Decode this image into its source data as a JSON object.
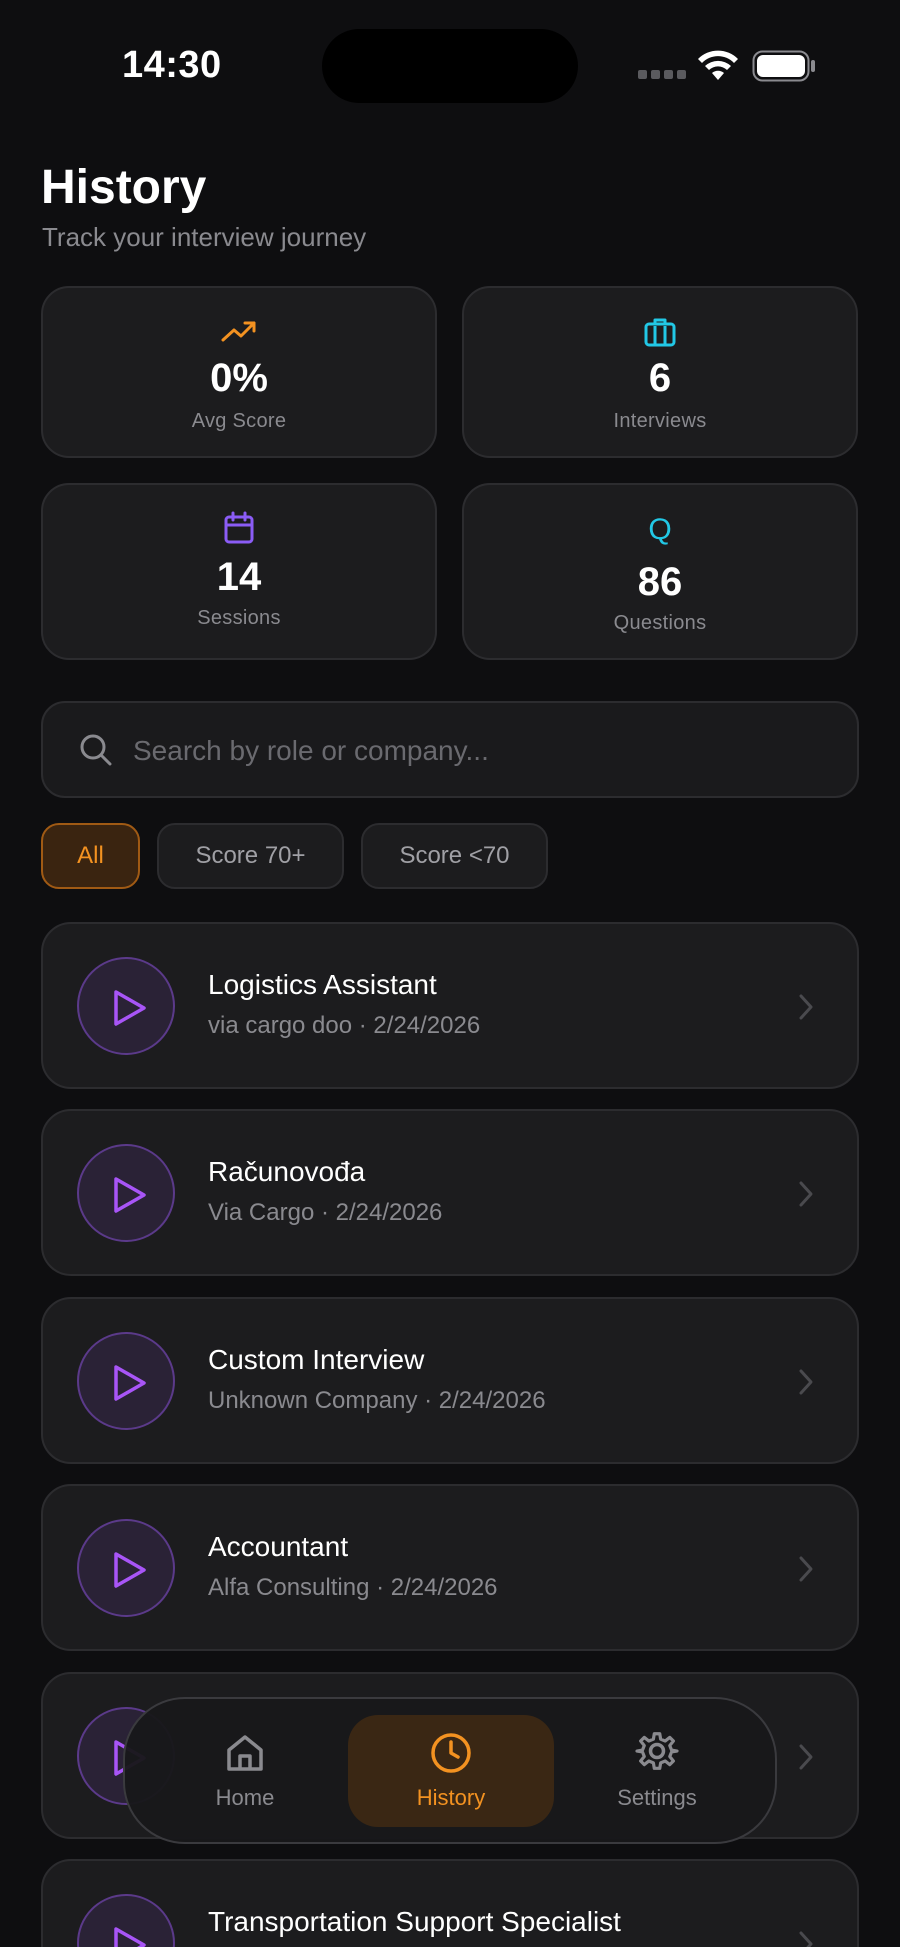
{
  "status_bar": {
    "time": "14:30"
  },
  "header": {
    "title": "History",
    "subtitle": "Track your interview journey"
  },
  "stats": [
    {
      "value": "0%",
      "label": "Avg Score",
      "icon": "trending-up-icon",
      "color": "#f39221"
    },
    {
      "value": "6",
      "label": "Interviews",
      "icon": "briefcase-icon",
      "color": "#22c8e6"
    },
    {
      "value": "14",
      "label": "Sessions",
      "icon": "calendar-icon",
      "color": "#8b5cf6"
    },
    {
      "value": "86",
      "label": "Questions",
      "icon": "q-icon",
      "icon_text": "Q",
      "color": "#22c8e6"
    }
  ],
  "search": {
    "placeholder": "Search by role or company..."
  },
  "filters": [
    {
      "label": "All",
      "active": true
    },
    {
      "label": "Score 70+",
      "active": false
    },
    {
      "label": "Score <70",
      "active": false
    }
  ],
  "interviews": [
    {
      "title": "Logistics Assistant",
      "subtitle": "via cargo doo · 2/24/2026"
    },
    {
      "title": "Računovođa",
      "subtitle": "Via Cargo · 2/24/2026"
    },
    {
      "title": "Custom Interview",
      "subtitle": "Unknown Company · 2/24/2026"
    },
    {
      "title": "Accountant",
      "subtitle": "Alfa Consulting · 2/24/2026"
    },
    {
      "title": "",
      "subtitle": ""
    },
    {
      "title": "Transportation Support Specialist",
      "subtitle": ""
    }
  ],
  "nav": [
    {
      "label": "Home",
      "icon": "home-icon",
      "active": false
    },
    {
      "label": "History",
      "icon": "clock-icon",
      "active": true
    },
    {
      "label": "Settings",
      "icon": "gear-icon",
      "active": false
    }
  ],
  "colors": {
    "accent": "#f39221",
    "purple": "#8b5cf6",
    "cyan": "#22c8e6",
    "background": "#0e0e10",
    "card": "#1c1c1e"
  }
}
